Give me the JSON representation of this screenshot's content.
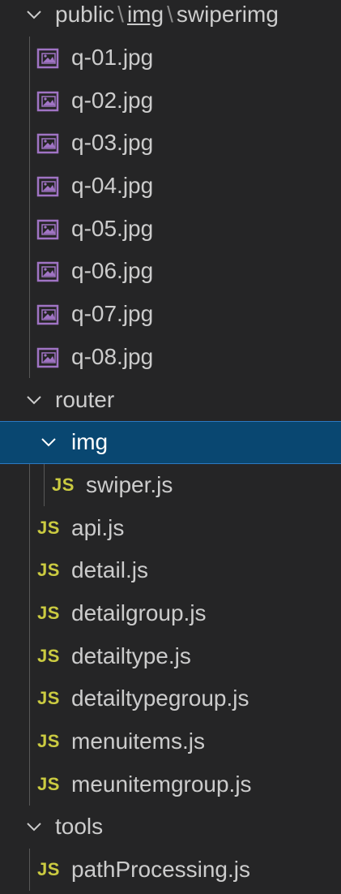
{
  "tree": {
    "public_folder": {
      "part1": "public",
      "sep1": "\\",
      "part2": "img",
      "sep2": "\\",
      "part3": "swiperimg"
    },
    "images": [
      {
        "label": "q-01.jpg",
        "icon": "image-file-icon"
      },
      {
        "label": "q-02.jpg",
        "icon": "image-file-icon"
      },
      {
        "label": "q-03.jpg",
        "icon": "image-file-icon"
      },
      {
        "label": "q-04.jpg",
        "icon": "image-file-icon"
      },
      {
        "label": "q-05.jpg",
        "icon": "image-file-icon"
      },
      {
        "label": "q-06.jpg",
        "icon": "image-file-icon"
      },
      {
        "label": "q-07.jpg",
        "icon": "image-file-icon"
      },
      {
        "label": "q-08.jpg",
        "icon": "image-file-icon"
      }
    ],
    "router_folder": {
      "label": "router"
    },
    "img_folder": {
      "label": "img",
      "selected": true
    },
    "img_files": [
      {
        "label": "swiper.js",
        "badge": "JS"
      }
    ],
    "router_files": [
      {
        "label": "api.js",
        "badge": "JS"
      },
      {
        "label": "detail.js",
        "badge": "JS"
      },
      {
        "label": "detailgroup.js",
        "badge": "JS"
      },
      {
        "label": "detailtype.js",
        "badge": "JS"
      },
      {
        "label": "detailtypegroup.js",
        "badge": "JS"
      },
      {
        "label": "menuitems.js",
        "badge": "JS"
      },
      {
        "label": "meunitemgroup.js",
        "badge": "JS"
      }
    ],
    "tools_folder": {
      "label": "tools"
    },
    "tools_files": [
      {
        "label": "pathProcessing.js",
        "badge": "JS"
      }
    ]
  },
  "colors": {
    "background": "#252526",
    "selected": "#094771",
    "js_badge": "#cbcb41",
    "image_icon": "#a074c4"
  }
}
